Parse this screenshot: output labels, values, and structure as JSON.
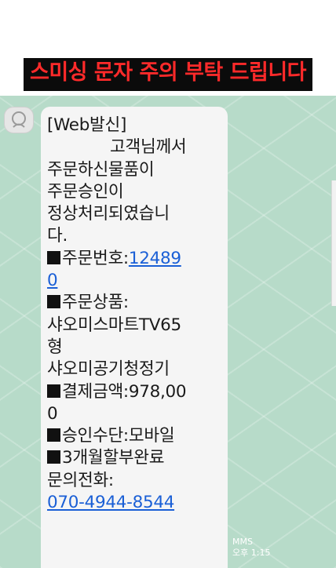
{
  "warning_banner": "스미싱 문자 주의 부탁 드립니다",
  "message": {
    "sender_tag": "[Web발신]",
    "greeting": "고객님께서",
    "line_ordered": "주문하신물품이",
    "line_approved": "주문승인이",
    "line_processed_1": "정상처리되였습니",
    "line_processed_2": "다.",
    "order_no_label": "주문번호:",
    "order_no_link_1": "12489",
    "order_no_link_2": "0",
    "product_label": "주문상품:",
    "product_name_1": "샤오미스마트TV65",
    "product_name_2": "형",
    "product_name_3": "샤오미공기청정기",
    "amount_line_1": "결제금액:978,00",
    "amount_line_2": "0",
    "method_line": "승인수단:모바일",
    "installment_line": "3개월할부완료",
    "contact_label": "문의전화:",
    "contact_phone": "070-4944-8544"
  },
  "meta": {
    "type": "MMS",
    "time": "오후 1:15"
  },
  "colors": {
    "banner_text": "#ff2a2a",
    "banner_bg": "#0b0b0b",
    "chat_bg": "#b7dbc9",
    "bubble_bg": "#f5f5f5",
    "link": "#1a5fd6"
  }
}
